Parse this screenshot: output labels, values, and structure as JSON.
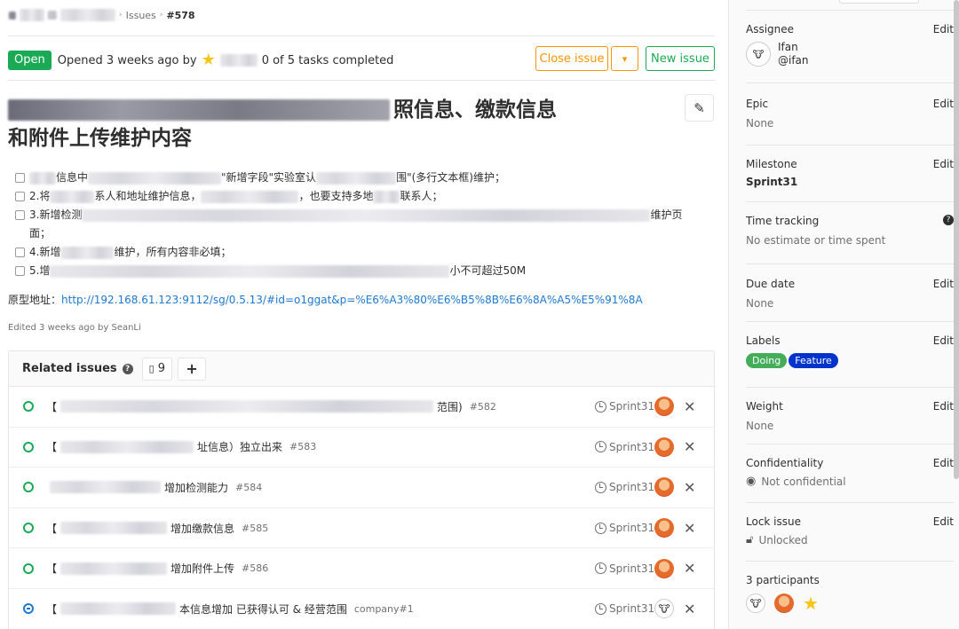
{
  "breadcrumb": {
    "sep": "›",
    "issues": "Issues",
    "current": "#578"
  },
  "status": {
    "badge": "Open",
    "opened_text": "Opened 3 weeks ago by",
    "tasks_text": "0 of 5 tasks completed"
  },
  "actions": {
    "close_issue": "Close issue",
    "dropdown": "▾",
    "new_issue": "New issue"
  },
  "issue_title": {
    "line1_visible": "照信息、缴款信息",
    "line2": "和附件上传维护内容"
  },
  "tasks": [
    {
      "fragments": [
        "信息中",
        "\"新增字段\"实验室认",
        "围\"(多行文本框)维护；"
      ]
    },
    {
      "fragments": [
        "2.将",
        "系人和地址维护信息，",
        "，也要支持多地",
        "联系人；"
      ]
    },
    {
      "fragments": [
        "3.新增检测",
        "",
        "维护页"
      ],
      "cont": "面；"
    },
    {
      "fragments": [
        "4.新增",
        "维护，所有内容非必填；"
      ]
    },
    {
      "fragments": [
        "5.增",
        "小不可超过50M"
      ]
    }
  ],
  "prototype": {
    "label": "原型地址：",
    "url": "http://192.168.61.123:9112/sg/0.5.13/#id=o1ggat&p=%E6%A3%80%E6%B5%8B%E6%8A%A5%E5%91%8A"
  },
  "edited": "Edited 3 weeks ago by SeanLi",
  "related": {
    "title": "Related issues",
    "count": "9",
    "add": "+",
    "rows": [
      {
        "prefix": "【",
        "suffix": "范围)",
        "ref": "#582",
        "milestone": "Sprint31",
        "avatar": "fox",
        "closed": false
      },
      {
        "prefix": "【",
        "suffix": "址信息）独立出来",
        "ref": "#583",
        "milestone": "Sprint31",
        "avatar": "fox",
        "closed": false
      },
      {
        "prefix": "",
        "suffix": "增加检测能力",
        "ref": "#584",
        "milestone": "Sprint31",
        "avatar": "fox",
        "closed": false
      },
      {
        "prefix": "【",
        "suffix": "增加缴款信息",
        "ref": "#585",
        "milestone": "Sprint31",
        "avatar": "fox",
        "closed": false
      },
      {
        "prefix": "【",
        "suffix": "增加附件上传",
        "ref": "#586",
        "milestone": "Sprint31",
        "avatar": "fox",
        "closed": false
      },
      {
        "prefix": "【",
        "suffix": "本信息增加 已获得认可 & 经营范围",
        "ref": "company#1",
        "milestone": "Sprint31",
        "avatar": "cow",
        "closed": true
      }
    ]
  },
  "sidebar": {
    "edit": "Edit",
    "assignee": {
      "label": "Assignee",
      "name": "Ifan",
      "username": "@ifan"
    },
    "epic": {
      "label": "Epic",
      "value": "None"
    },
    "milestone": {
      "label": "Milestone",
      "value": "Sprint31"
    },
    "time_tracking": {
      "label": "Time tracking",
      "value": "No estimate or time spent"
    },
    "due_date": {
      "label": "Due date",
      "value": "None"
    },
    "labels": {
      "label": "Labels",
      "items": [
        {
          "text": "Doing",
          "color": "#44ad5a"
        },
        {
          "text": "Feature",
          "color": "#0033cc"
        }
      ]
    },
    "weight": {
      "label": "Weight",
      "value": "None"
    },
    "confidentiality": {
      "label": "Confidentiality",
      "value": "Not confidential"
    },
    "lock": {
      "label": "Lock issue",
      "value": "Unlocked"
    },
    "participants": {
      "label": "3 participants"
    }
  },
  "colors": {
    "open_green": "#1aaa55",
    "warning_orange": "#fc9403",
    "link_blue": "#1f78d1"
  }
}
